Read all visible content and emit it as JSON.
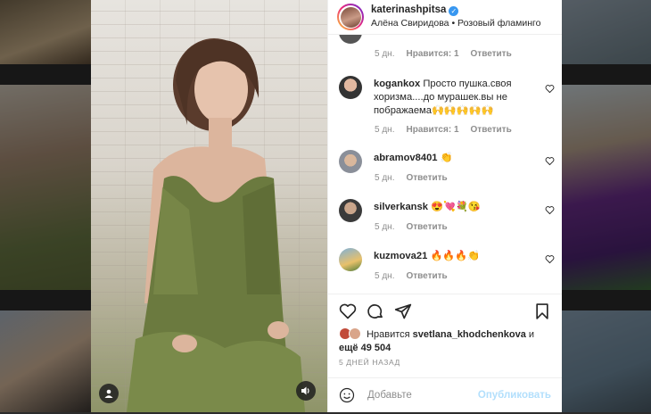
{
  "post": {
    "username": "katerinashpitsa",
    "verified_mark": "✓",
    "subtitle": "Алёна Свиридова • Розовый фламинго"
  },
  "comments": [
    {
      "username": "",
      "text": "",
      "age": "5 дн.",
      "likes": "Нравится: 1",
      "reply": "Ответить"
    },
    {
      "username": "kogankox",
      "text": "Просто пушка.своя хоризма....до мурашек.вы не пображаема🙌🙌🙌🙌🙌",
      "age": "5 дн.",
      "likes": "Нравится: 1",
      "reply": "Ответить"
    },
    {
      "username": "abramov8401",
      "text": "👏",
      "age": "5 дн.",
      "reply": "Ответить"
    },
    {
      "username": "silverkansk",
      "text": "😍💘💐😘",
      "age": "5 дн.",
      "reply": "Ответить"
    },
    {
      "username": "kuzmova21",
      "text": "🔥🔥🔥👏",
      "age": "5 дн.",
      "reply": "Ответить"
    }
  ],
  "likes": {
    "prefix": "Нравится",
    "user": "svetlana_khodchenkova",
    "conj": "и",
    "more": "ещё 49 504"
  },
  "date": "5 ДНЕЙ НАЗАД",
  "composer": {
    "placeholder": "Добавьте",
    "publish": "Опубликовать"
  },
  "colors": {
    "verified": "#3897f0",
    "publish_disabled": "#b2dffc",
    "meta": "#8e8e8e"
  },
  "icons": [
    "heart-icon",
    "comment-icon",
    "share-icon",
    "bookmark-icon",
    "smiley-icon",
    "user-icon",
    "sound-icon"
  ]
}
